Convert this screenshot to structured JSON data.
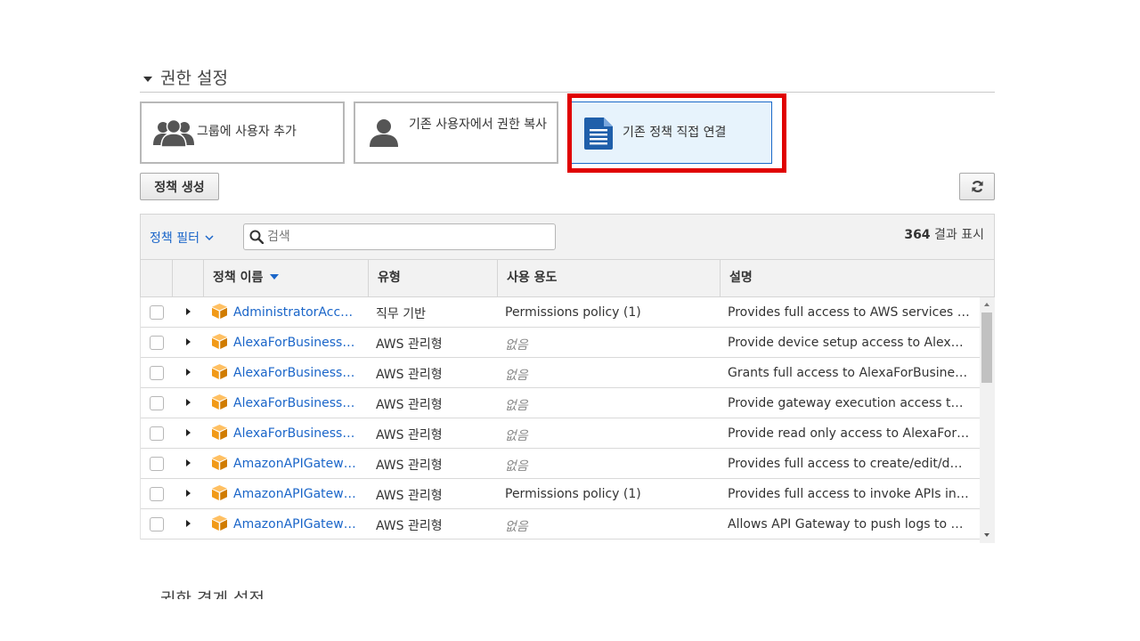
{
  "section": {
    "title": "권한 설정"
  },
  "options": [
    {
      "label": "그룹에 사용자 추가",
      "icon": "users-group-icon"
    },
    {
      "label": "기존 사용자에서 권한 복사",
      "icon": "user-icon"
    },
    {
      "label": "기존 정책 직접 연결",
      "icon": "document-icon",
      "selected": true
    }
  ],
  "toolbar": {
    "create_policy_label": "정책 생성",
    "refresh_icon": "refresh-icon"
  },
  "filter": {
    "dropdown_label": "정책 필터",
    "search_placeholder": "검색",
    "result_count": "364",
    "result_suffix": "결과 표시"
  },
  "table": {
    "columns": {
      "name": "정책 이름",
      "type": "유형",
      "usage": "사용 용도",
      "description": "설명"
    },
    "rows": [
      {
        "name": "AdministratorAccess",
        "type": "직무 기반",
        "usage": "Permissions policy (1)",
        "description": "Provides full access to AWS services and resources."
      },
      {
        "name": "AlexaForBusinessDeviceSetup",
        "type": "AWS 관리형",
        "usage": "없음",
        "description": "Provide device setup access to AlexaForBusiness services"
      },
      {
        "name": "AlexaForBusinessFullAccess",
        "type": "AWS 관리형",
        "usage": "없음",
        "description": "Grants full access to AlexaForBusiness resources"
      },
      {
        "name": "AlexaForBusinessGatewayExecution",
        "type": "AWS 관리형",
        "usage": "없음",
        "description": "Provide gateway execution access to AlexaForBusiness"
      },
      {
        "name": "AlexaForBusinessReadOnlyAccess",
        "type": "AWS 관리형",
        "usage": "없음",
        "description": "Provide read only access to AlexaForBusiness services"
      },
      {
        "name": "AmazonAPIGatewayAdministrator",
        "type": "AWS 관리형",
        "usage": "없음",
        "description": "Provides full access to create/edit/delete APIs"
      },
      {
        "name": "AmazonAPIGatewayInvokeFullAccess",
        "type": "AWS 관리형",
        "usage": "Permissions policy (1)",
        "description": "Provides full access to invoke APIs in Amazon API Gateway."
      },
      {
        "name": "AmazonAPIGatewayPushToCloudWatchLogs",
        "type": "AWS 관리형",
        "usage": "없음",
        "description": "Allows API Gateway to push logs to user's account."
      }
    ]
  },
  "next_section": {
    "title": "권한 경계 설정"
  },
  "colors": {
    "accent": "#1b66c9",
    "highlight": "#e00000",
    "package": "#f19a18"
  }
}
